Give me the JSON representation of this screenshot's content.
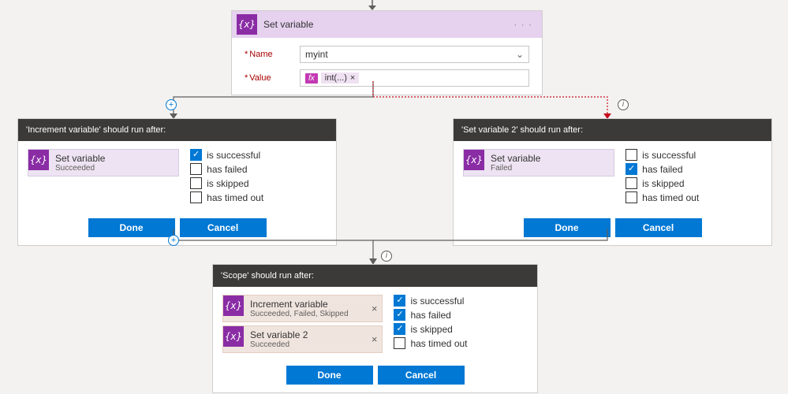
{
  "top_action": {
    "title": "Set variable",
    "name_label": "Name",
    "value_label": "Value",
    "name_value": "myint",
    "fx_label": "fx",
    "value_expr": "int(...)",
    "chip_close": "×",
    "menu": "· · ·"
  },
  "left_panel": {
    "header": "'Increment variable' should run after:",
    "cond_title": "Set variable",
    "cond_status": "Succeeded",
    "checks": {
      "is_successful": [
        "true",
        "is successful"
      ],
      "has_failed": [
        "false",
        "has failed"
      ],
      "is_skipped": [
        "false",
        "is skipped"
      ],
      "has_timed_out": [
        "false",
        "has timed out"
      ]
    }
  },
  "right_panel": {
    "header": "'Set variable 2' should run after:",
    "cond_title": "Set variable",
    "cond_status": "Failed",
    "checks": {
      "is_successful": [
        "false",
        "is successful"
      ],
      "has_failed": [
        "true",
        "has failed"
      ],
      "is_skipped": [
        "false",
        "is skipped"
      ],
      "has_timed_out": [
        "false",
        "has timed out"
      ]
    }
  },
  "bottom_panel": {
    "header": "'Scope' should run after:",
    "cond1_title": "Increment variable",
    "cond1_status": "Succeeded, Failed, Skipped",
    "cond2_title": "Set variable 2",
    "cond2_status": "Succeeded",
    "checks": {
      "is_successful": [
        "true",
        "is successful"
      ],
      "has_failed": [
        "true",
        "has failed"
      ],
      "is_skipped": [
        "true",
        "is skipped"
      ],
      "has_timed_out": [
        "false",
        "has timed out"
      ]
    }
  },
  "buttons": {
    "done": "Done",
    "cancel": "Cancel"
  },
  "checkmark": "✓",
  "icon_text": "{x}"
}
